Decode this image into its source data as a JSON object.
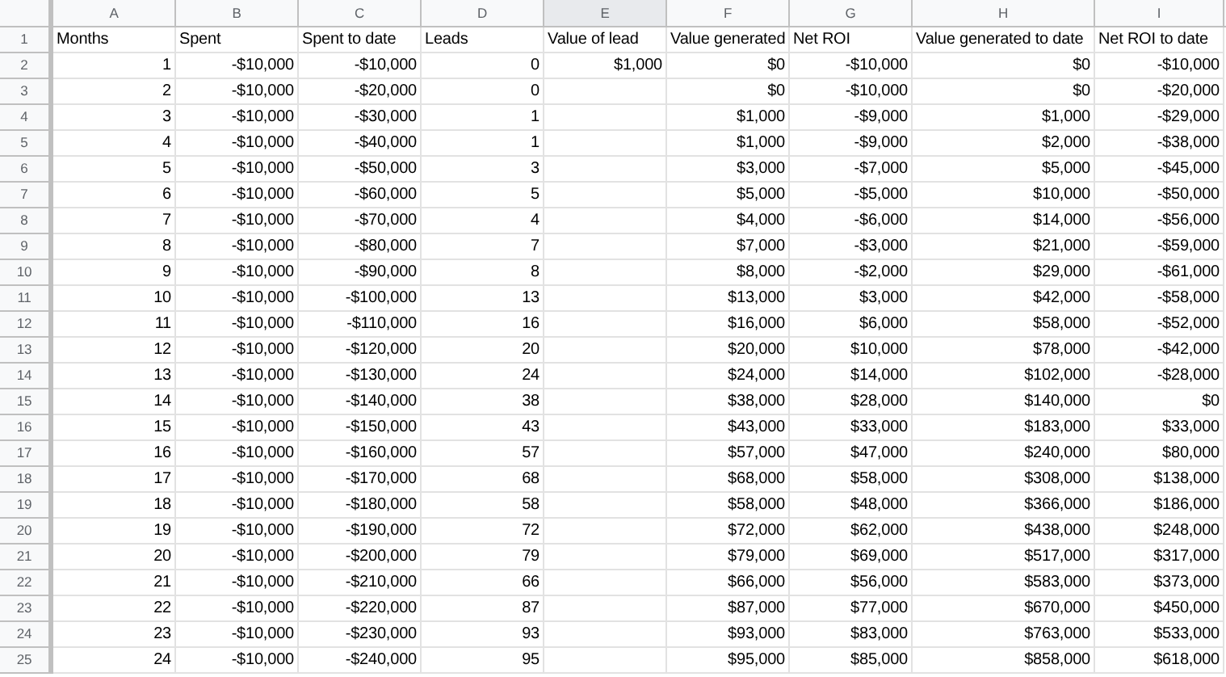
{
  "columns": [
    {
      "label": "A",
      "selected": false
    },
    {
      "label": "B",
      "selected": false
    },
    {
      "label": "C",
      "selected": false
    },
    {
      "label": "D",
      "selected": false
    },
    {
      "label": "E",
      "selected": true
    },
    {
      "label": "F",
      "selected": false
    },
    {
      "label": "G",
      "selected": false
    },
    {
      "label": "H",
      "selected": false
    },
    {
      "label": "I",
      "selected": false
    }
  ],
  "rows": [
    {
      "number": "1",
      "kind": "header",
      "cells": [
        "Months",
        "Spent",
        "Spent to date",
        "Leads",
        "Value of lead",
        "Value generated",
        "Net ROI",
        "Value generated to date",
        "Net ROI to date"
      ]
    },
    {
      "number": "2",
      "kind": "data",
      "cells": [
        "1",
        "-$10,000",
        "-$10,000",
        "0",
        "$1,000",
        "$0",
        "-$10,000",
        "$0",
        "-$10,000"
      ]
    },
    {
      "number": "3",
      "kind": "data",
      "cells": [
        "2",
        "-$10,000",
        "-$20,000",
        "0",
        null,
        "$0",
        "-$10,000",
        "$0",
        "-$20,000"
      ]
    },
    {
      "number": "4",
      "kind": "data",
      "cells": [
        "3",
        "-$10,000",
        "-$30,000",
        "1",
        null,
        "$1,000",
        "-$9,000",
        "$1,000",
        "-$29,000"
      ]
    },
    {
      "number": "5",
      "kind": "data",
      "cells": [
        "4",
        "-$10,000",
        "-$40,000",
        "1",
        null,
        "$1,000",
        "-$9,000",
        "$2,000",
        "-$38,000"
      ]
    },
    {
      "number": "6",
      "kind": "data",
      "cells": [
        "5",
        "-$10,000",
        "-$50,000",
        "3",
        null,
        "$3,000",
        "-$7,000",
        "$5,000",
        "-$45,000"
      ]
    },
    {
      "number": "7",
      "kind": "data",
      "cells": [
        "6",
        "-$10,000",
        "-$60,000",
        "5",
        null,
        "$5,000",
        "-$5,000",
        "$10,000",
        "-$50,000"
      ]
    },
    {
      "number": "8",
      "kind": "data",
      "cells": [
        "7",
        "-$10,000",
        "-$70,000",
        "4",
        null,
        "$4,000",
        "-$6,000",
        "$14,000",
        "-$56,000"
      ]
    },
    {
      "number": "9",
      "kind": "data",
      "cells": [
        "8",
        "-$10,000",
        "-$80,000",
        "7",
        null,
        "$7,000",
        "-$3,000",
        "$21,000",
        "-$59,000"
      ]
    },
    {
      "number": "10",
      "kind": "data",
      "cells": [
        "9",
        "-$10,000",
        "-$90,000",
        "8",
        null,
        "$8,000",
        "-$2,000",
        "$29,000",
        "-$61,000"
      ]
    },
    {
      "number": "11",
      "kind": "data",
      "cells": [
        "10",
        "-$10,000",
        "-$100,000",
        "13",
        null,
        "$13,000",
        "$3,000",
        "$42,000",
        "-$58,000"
      ]
    },
    {
      "number": "12",
      "kind": "data",
      "cells": [
        "11",
        "-$10,000",
        "-$110,000",
        "16",
        null,
        "$16,000",
        "$6,000",
        "$58,000",
        "-$52,000"
      ]
    },
    {
      "number": "13",
      "kind": "data",
      "cells": [
        "12",
        "-$10,000",
        "-$120,000",
        "20",
        null,
        "$20,000",
        "$10,000",
        "$78,000",
        "-$42,000"
      ]
    },
    {
      "number": "14",
      "kind": "data",
      "cells": [
        "13",
        "-$10,000",
        "-$130,000",
        "24",
        null,
        "$24,000",
        "$14,000",
        "$102,000",
        "-$28,000"
      ]
    },
    {
      "number": "15",
      "kind": "data",
      "cells": [
        "14",
        "-$10,000",
        "-$140,000",
        "38",
        null,
        "$38,000",
        "$28,000",
        "$140,000",
        "$0"
      ]
    },
    {
      "number": "16",
      "kind": "data",
      "cells": [
        "15",
        "-$10,000",
        "-$150,000",
        "43",
        null,
        "$43,000",
        "$33,000",
        "$183,000",
        "$33,000"
      ]
    },
    {
      "number": "17",
      "kind": "data",
      "cells": [
        "16",
        "-$10,000",
        "-$160,000",
        "57",
        null,
        "$57,000",
        "$47,000",
        "$240,000",
        "$80,000"
      ]
    },
    {
      "number": "18",
      "kind": "data",
      "cells": [
        "17",
        "-$10,000",
        "-$170,000",
        "68",
        null,
        "$68,000",
        "$58,000",
        "$308,000",
        "$138,000"
      ]
    },
    {
      "number": "19",
      "kind": "data",
      "cells": [
        "18",
        "-$10,000",
        "-$180,000",
        "58",
        null,
        "$58,000",
        "$48,000",
        "$366,000",
        "$186,000"
      ]
    },
    {
      "number": "20",
      "kind": "data",
      "cells": [
        "19",
        "-$10,000",
        "-$190,000",
        "72",
        null,
        "$72,000",
        "$62,000",
        "$438,000",
        "$248,000"
      ]
    },
    {
      "number": "21",
      "kind": "data",
      "cells": [
        "20",
        "-$10,000",
        "-$200,000",
        "79",
        null,
        "$79,000",
        "$69,000",
        "$517,000",
        "$317,000"
      ]
    },
    {
      "number": "22",
      "kind": "data",
      "cells": [
        "21",
        "-$10,000",
        "-$210,000",
        "66",
        null,
        "$66,000",
        "$56,000",
        "$583,000",
        "$373,000"
      ]
    },
    {
      "number": "23",
      "kind": "data",
      "cells": [
        "22",
        "-$10,000",
        "-$220,000",
        "87",
        null,
        "$87,000",
        "$77,000",
        "$670,000",
        "$450,000"
      ]
    },
    {
      "number": "24",
      "kind": "data",
      "cells": [
        "23",
        "-$10,000",
        "-$230,000",
        "93",
        null,
        "$93,000",
        "$83,000",
        "$763,000",
        "$533,000"
      ]
    },
    {
      "number": "25",
      "kind": "data",
      "cells": [
        "24",
        "-$10,000",
        "-$240,000",
        "95",
        null,
        "$95,000",
        "$85,000",
        "$858,000",
        "$618,000"
      ]
    }
  ]
}
